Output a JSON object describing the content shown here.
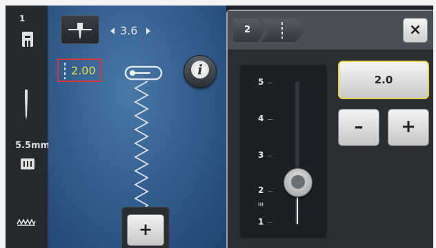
{
  "status": {
    "needle_number": "1",
    "needle_size": "5.5mm"
  },
  "stitch": {
    "width_value": "3.6",
    "length_value": "2.00"
  },
  "panel": {
    "breadcrumb_step": "2",
    "close_symbol": "×",
    "current_value": "2.0",
    "decrease_label": "–",
    "increase_label": "+",
    "scale": {
      "ticks": [
        "5",
        "4",
        "3",
        "2",
        "1"
      ],
      "minor_marker": "III",
      "value": 2.0,
      "min": 1,
      "max": 5
    }
  },
  "add_button_label": "+"
}
